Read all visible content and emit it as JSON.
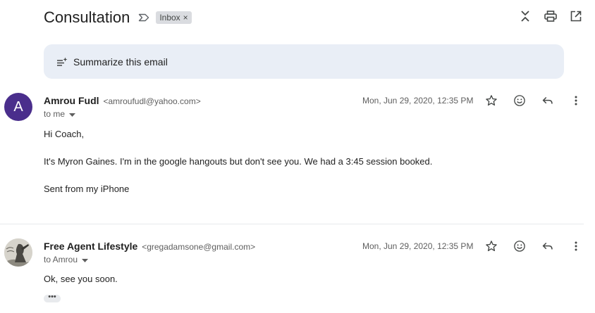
{
  "thread": {
    "subject": "Consultation",
    "label_chip": "Inbox",
    "label_chip_remove": "×"
  },
  "summarize": {
    "label": "Summarize this email"
  },
  "messages": [
    {
      "avatar_letter": "A",
      "avatar_color": "#4a2e8c",
      "sender_name": "Amrou Fudl",
      "sender_email": "<amroufudl@yahoo.com>",
      "to": "to me",
      "date": "Mon, Jun 29, 2020, 12:35 PM",
      "body": [
        "Hi Coach,",
        "It's Myron Gaines. I'm in the google hangouts but don't see you. We had a 3:45 session booked.",
        "Sent from my iPhone"
      ]
    },
    {
      "sender_name": "Free Agent Lifestyle",
      "sender_email": "<gregadamsone@gmail.com>",
      "to": "to Amrou",
      "date": "Mon, Jun 29, 2020, 12:35 PM",
      "body": [
        "Ok, see you soon."
      ],
      "trimmed_content": "•••"
    }
  ],
  "icons": {
    "top": [
      "collapse-all-icon",
      "print-icon",
      "open-new-window-icon"
    ],
    "message_actions": [
      "star-icon",
      "emoji-reaction-icon",
      "reply-icon",
      "more-vert-icon"
    ]
  },
  "colors": {
    "summarize_bg": "#e9eef6",
    "chip_bg": "#dadce0"
  }
}
